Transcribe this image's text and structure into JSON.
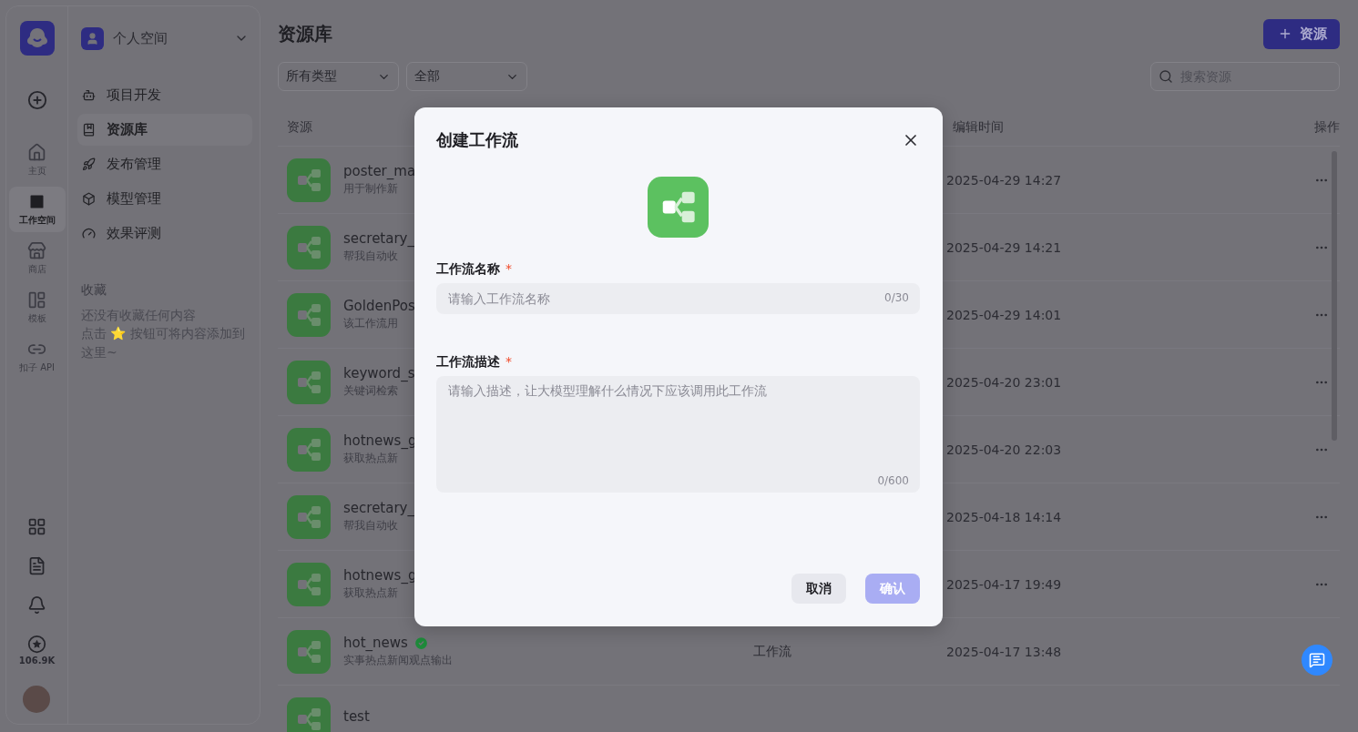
{
  "rail": {
    "items": [
      {
        "label": "主页",
        "selected": false
      },
      {
        "label": "工作空间",
        "selected": true
      },
      {
        "label": "商店",
        "selected": false
      },
      {
        "label": "模板",
        "selected": false
      },
      {
        "label": "扣子 API",
        "selected": false
      }
    ],
    "points": "106.9K"
  },
  "sidebar": {
    "workspace": "个人空间",
    "menu": [
      {
        "label": "项目开发",
        "selected": false
      },
      {
        "label": "资源库",
        "selected": true
      },
      {
        "label": "发布管理",
        "selected": false
      },
      {
        "label": "模型管理",
        "selected": false
      },
      {
        "label": "效果评测",
        "selected": false
      }
    ],
    "favorites": {
      "title": "收藏",
      "empty_lines": [
        "还没有收藏任何内容",
        "点击 ⭐ 按钮可将内容添加到这里~"
      ]
    }
  },
  "main": {
    "title": "资源库",
    "add_button": "资源",
    "filters": [
      {
        "value": "所有类型"
      },
      {
        "value": "全部"
      }
    ],
    "search": {
      "placeholder": "搜索资源"
    },
    "table": {
      "columns": [
        "资源",
        "编辑时间",
        "操作"
      ],
      "rows": [
        {
          "name": "poster_ma",
          "description": "用于制作新",
          "time": "2025-04-29 14:27"
        },
        {
          "name": "secretary_",
          "description": "帮我自动收",
          "time": "2025-04-29 14:21"
        },
        {
          "name": "GoldenPos",
          "description": "该工作流用",
          "time": "2025-04-29 14:01"
        },
        {
          "name": "keyword_s",
          "description": "关键词检索",
          "time": "2025-04-20 23:01"
        },
        {
          "name": "hotnews_g",
          "description": "获取热点新",
          "time": "2025-04-20 22:03"
        },
        {
          "name": "secretary_",
          "description": "帮我自动收",
          "time": "2025-04-18 14:14"
        },
        {
          "name": "hotnews_g",
          "description": "获取热点新",
          "time": "2025-04-17 19:49"
        },
        {
          "name": "hot_news",
          "description": "实事热点新闻观点输出",
          "type": "工作流",
          "time": "2025-04-17 13:48",
          "verified": true
        },
        {
          "name": "test"
        }
      ]
    }
  },
  "modal": {
    "title": "创建工作流",
    "fields": [
      {
        "kind": "input",
        "label": "工作流名称",
        "required_mark": "*",
        "placeholder": "请输入工作流名称",
        "counter": "0/30"
      },
      {
        "kind": "textarea",
        "label": "工作流描述",
        "required_mark": "*",
        "placeholder": "请输入描述，让大模型理解什么情况下应该调用此工作流",
        "counter": "0/600"
      }
    ],
    "buttons": [
      {
        "label": "取消",
        "kind": "secondary"
      },
      {
        "label": "确认",
        "kind": "primary",
        "disabled": true
      }
    ]
  }
}
